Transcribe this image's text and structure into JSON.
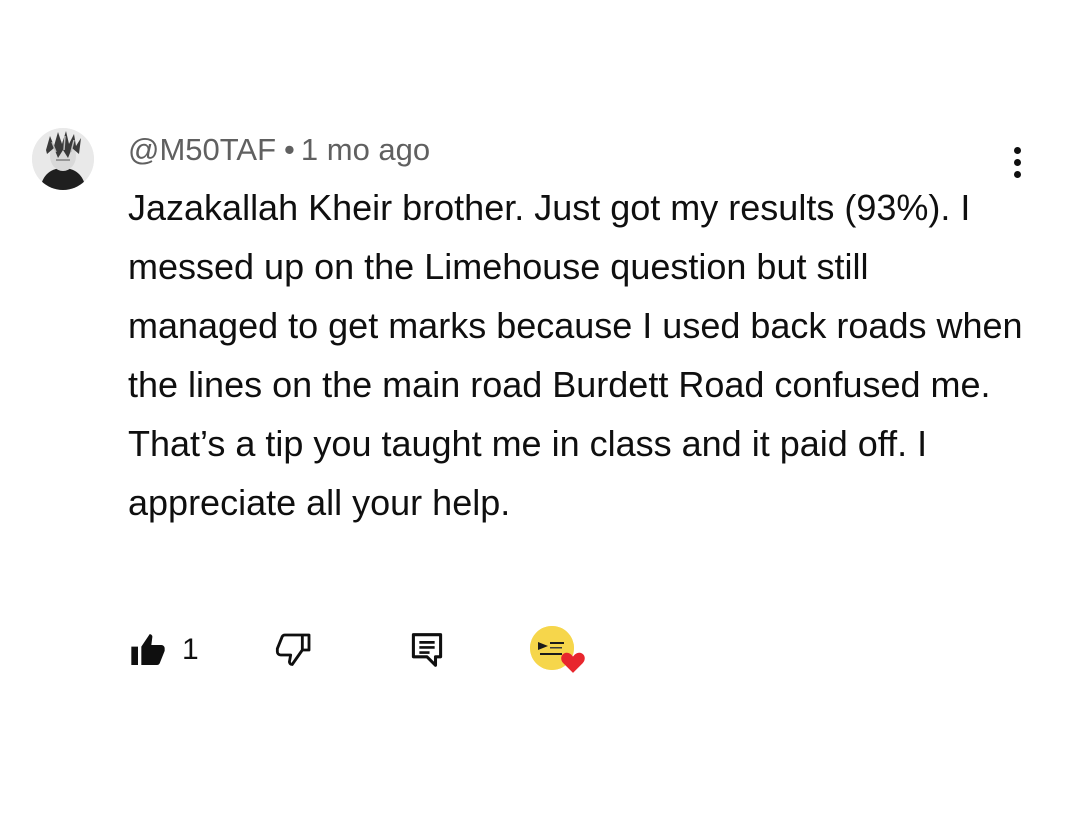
{
  "comment": {
    "handle": "@M50TAF",
    "separator": "•",
    "time_ago": "1 mo ago",
    "body": "Jazakallah Kheir brother. Just got my results (93%). I messed up on the Limehouse question but still managed to get marks because I used back roads when the lines on the main road Burdett Road confused me. That’s a tip you taught me in class and it paid off. I appreciate all your help.",
    "like_count": "1",
    "more_icon": "vertical-ellipsis-icon",
    "like_icon": "thumbs-up-filled-icon",
    "dislike_icon": "thumbs-down-outline-icon",
    "reply_icon": "comment-reply-icon",
    "creator_heart_icon": "heart-icon",
    "colors": {
      "meta_text": "#606060",
      "body_text": "#0f0f0f",
      "heart": "#e8262d",
      "creator_avatar_bg": "#f6d64b"
    }
  }
}
